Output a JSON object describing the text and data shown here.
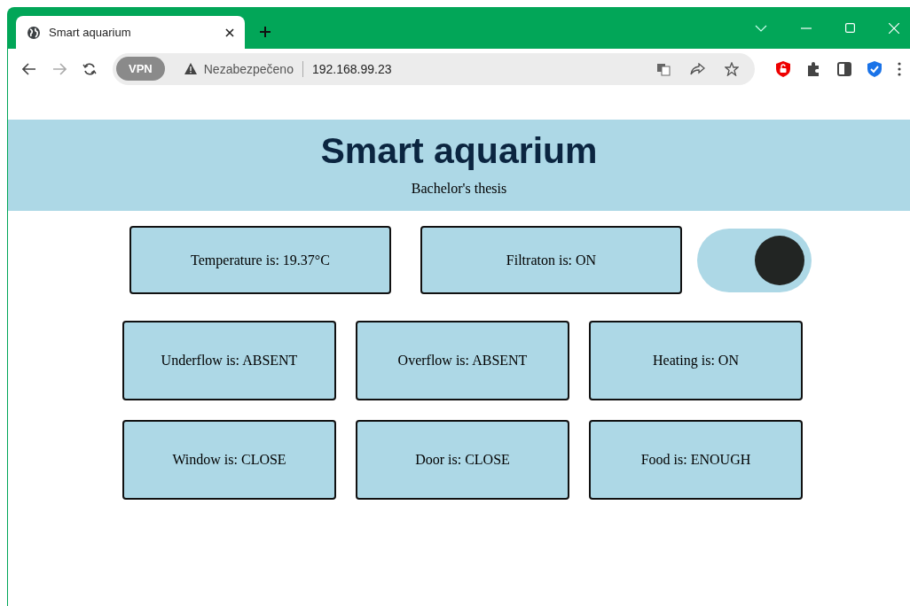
{
  "browser": {
    "tab_title": "Smart aquarium",
    "vpn_label": "VPN",
    "security_label": "Nezabezpečeno",
    "url": "192.168.99.23"
  },
  "header": {
    "title": "Smart aquarium",
    "subtitle": "Bachelor's thesis"
  },
  "top_row": [
    {
      "text": "Temperature is: 19.37°C"
    },
    {
      "text": "Filtraton is: ON"
    }
  ],
  "toggle": {
    "on": true
  },
  "grid": [
    {
      "text": "Underflow is: ABSENT"
    },
    {
      "text": "Overflow is: ABSENT"
    },
    {
      "text": "Heating is: ON"
    },
    {
      "text": "Window is: CLOSE"
    },
    {
      "text": "Door is: CLOSE"
    },
    {
      "text": "Food is: ENOUGH"
    }
  ]
}
